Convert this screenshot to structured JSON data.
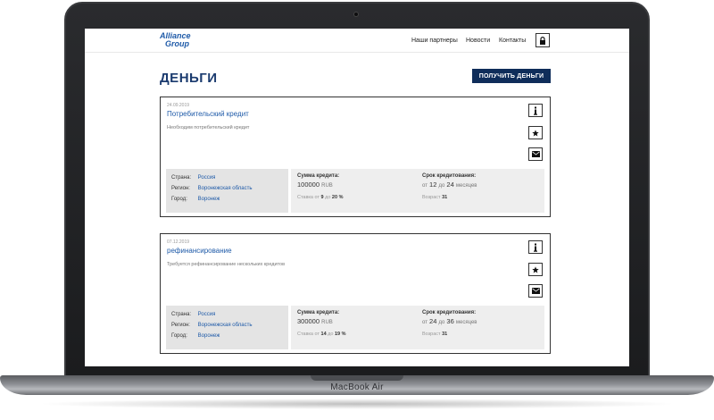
{
  "device": {
    "label": "MacBook Air"
  },
  "header": {
    "logo_line1": "Alliance",
    "logo_line2": "Group",
    "nav": [
      "Наши партнеры",
      "Новости",
      "Контакты"
    ]
  },
  "page": {
    "title": "ДЕНЬГИ",
    "cta_label": "ПОЛУЧИТЬ ДЕНЬГИ"
  },
  "labels": {
    "country": "Страна:",
    "region": "Регион:",
    "city": "Город:",
    "amount": "Сумма кредита:",
    "term": "Срок кредитования:",
    "rate_prefix": "Ставка от",
    "rate_mid": "до",
    "rate_suffix": "%",
    "term_from": "от",
    "term_to": "до",
    "term_unit": "месяцев",
    "age": "Возраст",
    "currency": "RUB"
  },
  "cards": [
    {
      "date": "24.09.2019",
      "title": "Потребительский кредит",
      "description": "Необходим потребительский кредит",
      "country": "Россия",
      "region": "Воронежская область",
      "city": "Воронеж",
      "amount": "100000",
      "rate_from": "9",
      "rate_to": "20",
      "term_from": "12",
      "term_to": "24",
      "age": "31"
    },
    {
      "date": "07.12.2019",
      "title": "рефинансирование",
      "description": "Требуется рефинансирование нескольких кредитов",
      "country": "Россия",
      "region": "Воронежская область",
      "city": "Воронеж",
      "amount": "300000",
      "rate_from": "14",
      "rate_to": "19",
      "term_from": "24",
      "term_to": "36",
      "age": "31"
    }
  ],
  "icons": {
    "info": "info-icon",
    "star": "star-icon",
    "mail": "mail-icon",
    "lock": "lock-icon"
  }
}
